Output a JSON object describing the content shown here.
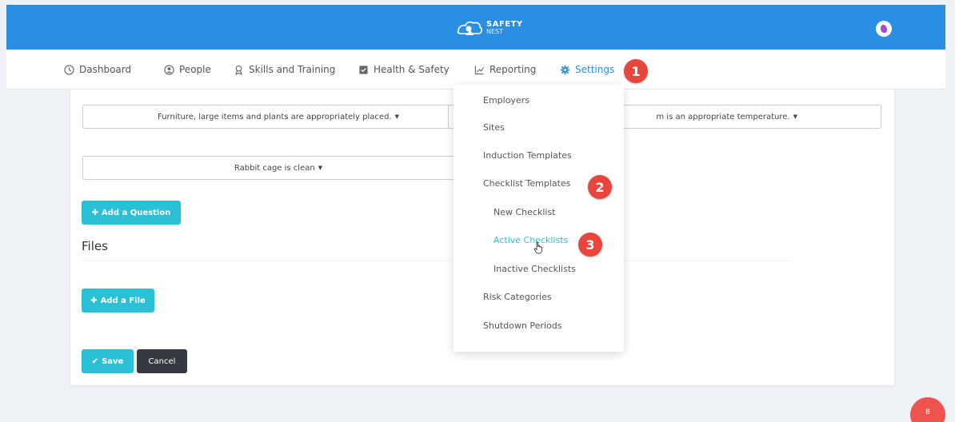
{
  "header": {
    "logo_line1": "SAFETY",
    "logo_line2": "NEST",
    "brand_color": "#2a8ee3"
  },
  "nav": {
    "items": [
      {
        "label": "Dashboard",
        "icon": "clock-icon"
      },
      {
        "label": "People",
        "icon": "user-circle-icon"
      },
      {
        "label": "Skills and Training",
        "icon": "award-icon"
      },
      {
        "label": "Health & Safety",
        "icon": "checklist-icon"
      },
      {
        "label": "Reporting",
        "icon": "line-chart-icon"
      },
      {
        "label": "Settings",
        "icon": "gear-icon",
        "active": true
      }
    ]
  },
  "annotations": {
    "step1": "1",
    "step2": "2",
    "step3": "3",
    "color": "#e8453c"
  },
  "form": {
    "questions": [
      "Furniture, large items and plants are appropriately placed.",
      "m is an appropriate temperature.",
      "Rabbit cage is clean"
    ],
    "add_question_label": "Add a Question",
    "files_heading": "Files",
    "add_file_label": "Add a File",
    "save_label": "Save",
    "cancel_label": "Cancel"
  },
  "settings_menu": {
    "items": [
      {
        "label": "Employers"
      },
      {
        "label": "Sites"
      },
      {
        "label": "Induction Templates"
      },
      {
        "label": "Checklist Templates"
      },
      {
        "label": "New Checklist",
        "sub": true
      },
      {
        "label": "Active Checklists",
        "sub": true,
        "hovered": true
      },
      {
        "label": "Inactive Checklists",
        "sub": true
      },
      {
        "label": "Risk Categories"
      },
      {
        "label": "Shutdown Periods"
      }
    ],
    "hover_color": "#2cc0d6"
  },
  "fab": {
    "label": "8"
  }
}
